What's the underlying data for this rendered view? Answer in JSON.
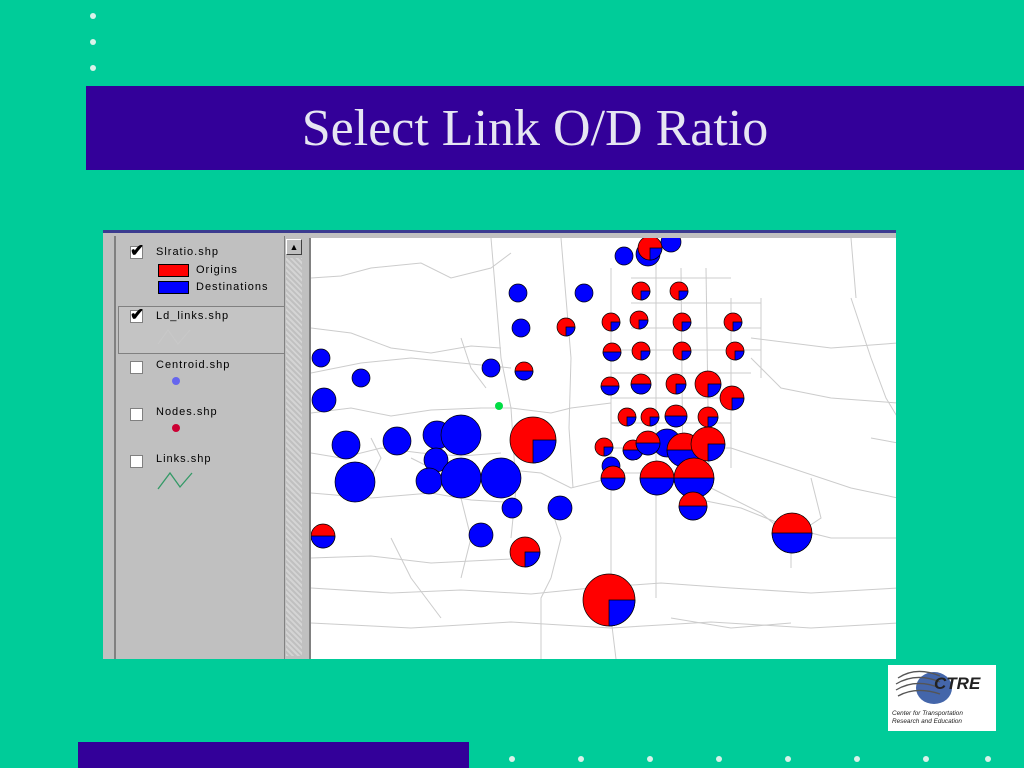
{
  "slide": {
    "title": "Select Link O/D Ratio",
    "colors": {
      "background": "#00CC99",
      "title_band": "#330099",
      "origin": "#FF0000",
      "destination": "#0000FF"
    }
  },
  "legend": {
    "layers": [
      {
        "name": "Slratio.shp",
        "checked": true,
        "entries": [
          {
            "label": "Origins",
            "color": "#FF0000"
          },
          {
            "label": "Destinations",
            "color": "#0000FF"
          }
        ]
      },
      {
        "name": "Ld_links.shp",
        "checked": true,
        "symbol": "line-icon",
        "symbol_color": "#C8C8C8"
      },
      {
        "name": "Centroid.shp",
        "checked": false,
        "symbol": "dot-icon",
        "symbol_color": "#6666EE"
      },
      {
        "name": "Nodes.shp",
        "checked": false,
        "symbol": "dot-icon",
        "symbol_color": "#CC0033"
      },
      {
        "name": "Links.shp",
        "checked": false,
        "symbol": "line-icon",
        "symbol_color": "#339966"
      }
    ],
    "scroll_up_icon": "scroll-up-arrow-icon"
  },
  "logo": {
    "name": "CTRE",
    "caption_line1": "Center for Transportation",
    "caption_line2": "Research and Education"
  }
}
